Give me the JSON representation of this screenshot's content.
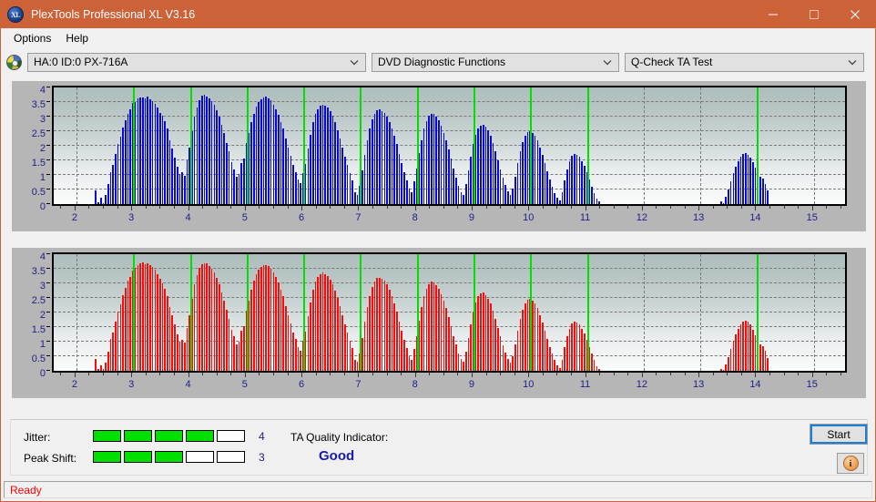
{
  "window": {
    "title": "PlexTools Professional XL V3.16",
    "app_icon": "xl-disc-icon",
    "minimize_label": "Minimize",
    "maximize_label": "Maximize",
    "close_label": "Close",
    "titlebar_color": "#cd6239"
  },
  "menu": {
    "items": [
      {
        "label": "Options"
      },
      {
        "label": "Help"
      }
    ]
  },
  "toolbar": {
    "drive_icon": "disc-icon",
    "drive_select": "HA:0 ID:0  PX-716A",
    "function_select": "DVD Diagnostic Functions",
    "test_select": "Q-Check TA Test"
  },
  "results": {
    "jitter_label": "Jitter:",
    "jitter_value": "4",
    "jitter_segments": 5,
    "jitter_filled": 4,
    "peak_shift_label": "Peak Shift:",
    "peak_shift_value": "3",
    "peak_shift_segments": 5,
    "peak_shift_filled": 3,
    "ta_label": "TA Quality Indicator:",
    "ta_value": "Good",
    "ta_value_color": "#1a1ab0",
    "meter_on_color": "#00e000",
    "start_label": "Start",
    "info_icon": "info-icon"
  },
  "statusbar": {
    "text": "Ready",
    "text_color": "#ff0000"
  },
  "chart_data": [
    {
      "id": "jitter-chart",
      "type": "bar",
      "title": "",
      "xlabel": "",
      "ylabel": "",
      "series_color": "#0a0ad0",
      "marker_color": "#00e000",
      "grid": true,
      "xlim": [
        1.6,
        15.55
      ],
      "ylim": [
        0,
        4
      ],
      "yticks": [
        0,
        0.5,
        1,
        1.5,
        2,
        2.5,
        3,
        3.5,
        4
      ],
      "ytick_labels": [
        "0",
        "0.5",
        "1",
        "1.5",
        "2",
        "2.5",
        "3",
        "3.5",
        "4"
      ],
      "xticks": [
        2,
        3,
        4,
        5,
        6,
        7,
        8,
        9,
        10,
        11,
        12,
        13,
        14,
        15
      ],
      "xtick_labels": [
        "2",
        "3",
        "4",
        "5",
        "6",
        "7",
        "8",
        "9",
        "10",
        "11",
        "12",
        "13",
        "14",
        "15"
      ],
      "markers": [
        3,
        4,
        5,
        6,
        7,
        8,
        9,
        10,
        11,
        14
      ],
      "bar_step": 0.0435,
      "x_start": 2.33,
      "values": [
        0.47,
        0.05,
        0.22,
        0.03,
        0.3,
        0.68,
        1.1,
        1.35,
        1.72,
        2.05,
        2.3,
        2.62,
        2.88,
        3.1,
        3.25,
        3.48,
        3.5,
        3.62,
        3.65,
        3.66,
        3.62,
        3.68,
        3.6,
        3.52,
        3.45,
        3.3,
        3.12,
        3.02,
        2.85,
        2.58,
        2.2,
        1.92,
        1.6,
        1.28,
        1.02,
        1.08,
        0.98,
        1.5,
        1.95,
        2.5,
        3.0,
        3.3,
        3.55,
        3.72,
        3.75,
        3.7,
        3.62,
        3.52,
        3.4,
        3.22,
        3.0,
        2.72,
        2.45,
        2.1,
        1.8,
        1.45,
        1.2,
        0.95,
        1.02,
        1.4,
        1.55,
        2.08,
        2.45,
        2.8,
        3.1,
        3.35,
        3.5,
        3.58,
        3.66,
        3.68,
        3.62,
        3.55,
        3.42,
        3.25,
        3.05,
        2.8,
        2.58,
        2.25,
        1.95,
        1.65,
        1.35,
        1.1,
        0.85,
        0.72,
        1.05,
        1.38,
        1.9,
        2.38,
        2.8,
        3.08,
        3.25,
        3.38,
        3.42,
        3.38,
        3.3,
        3.18,
        3.02,
        2.8,
        2.52,
        2.25,
        1.95,
        1.62,
        1.35,
        1.05,
        0.8,
        0.4,
        0.32,
        0.62,
        1.15,
        1.7,
        2.2,
        2.6,
        2.9,
        3.1,
        3.22,
        3.25,
        3.2,
        3.12,
        3.0,
        2.82,
        2.6,
        2.35,
        2.05,
        1.72,
        1.4,
        1.08,
        0.8,
        0.52,
        0.4,
        0.78,
        1.22,
        1.75,
        2.2,
        2.58,
        2.85,
        3.02,
        3.1,
        3.08,
        3.0,
        2.88,
        2.68,
        2.45,
        2.18,
        1.88,
        1.55,
        1.22,
        0.92,
        0.62,
        0.42,
        0.32,
        0.68,
        1.15,
        1.62,
        2.05,
        2.38,
        2.6,
        2.7,
        2.72,
        2.65,
        2.52,
        2.35,
        2.1,
        1.82,
        1.5,
        1.2,
        0.9,
        0.65,
        0.45,
        0.3,
        0.52,
        0.95,
        1.4,
        1.8,
        2.12,
        2.35,
        2.48,
        2.5,
        2.45,
        2.35,
        2.18,
        1.95,
        1.68,
        1.42,
        1.12,
        0.85,
        0.6,
        0.38,
        0.22,
        0.12,
        0.4,
        0.82,
        1.2,
        1.48,
        1.65,
        1.72,
        1.7,
        1.62,
        1.48,
        1.3,
        1.08,
        0.85,
        0.6,
        0.38,
        0.18,
        0.08
      ],
      "values_tail_x": 13.35,
      "values_tail": [
        0.08,
        0.02,
        0.25,
        0.5,
        0.78,
        1.05,
        1.28,
        1.48,
        1.62,
        1.72,
        1.75,
        1.7,
        1.6,
        1.45,
        1.25,
        1.02,
        0.95,
        0.88,
        0.7,
        0.48
      ]
    },
    {
      "id": "peak-shift-chart",
      "type": "bar",
      "title": "",
      "xlabel": "",
      "ylabel": "",
      "series_color": "#f01010",
      "marker_color": "#00e000",
      "grid": true,
      "xlim": [
        1.6,
        15.55
      ],
      "ylim": [
        0,
        4
      ],
      "yticks": [
        0,
        0.5,
        1,
        1.5,
        2,
        2.5,
        3,
        3.5,
        4
      ],
      "ytick_labels": [
        "0",
        "0.5",
        "1",
        "1.5",
        "2",
        "2.5",
        "3",
        "3.5",
        "4"
      ],
      "xticks": [
        2,
        3,
        4,
        5,
        6,
        7,
        8,
        9,
        10,
        11,
        12,
        13,
        14,
        15
      ],
      "xtick_labels": [
        "2",
        "3",
        "4",
        "5",
        "6",
        "7",
        "8",
        "9",
        "10",
        "11",
        "12",
        "13",
        "14",
        "15"
      ],
      "markers": [
        3,
        4,
        5,
        6,
        7,
        8,
        9,
        10,
        11,
        14
      ],
      "bar_step": 0.0435,
      "x_start": 2.33,
      "values": [
        0.42,
        0.06,
        0.2,
        0.05,
        0.28,
        0.65,
        1.08,
        1.32,
        1.7,
        2.02,
        2.28,
        2.58,
        2.85,
        3.08,
        3.22,
        3.45,
        3.52,
        3.62,
        3.7,
        3.72,
        3.66,
        3.7,
        3.62,
        3.55,
        3.46,
        3.32,
        3.15,
        3.0,
        2.82,
        2.55,
        2.18,
        1.9,
        1.58,
        1.25,
        1.0,
        1.05,
        0.96,
        1.48,
        1.92,
        2.48,
        2.98,
        3.28,
        3.52,
        3.66,
        3.7,
        3.68,
        3.58,
        3.5,
        3.38,
        3.2,
        2.98,
        2.7,
        2.42,
        2.08,
        1.78,
        1.42,
        1.18,
        0.92,
        1.0,
        1.38,
        1.52,
        2.05,
        2.42,
        2.78,
        3.08,
        3.32,
        3.48,
        3.55,
        3.62,
        3.64,
        3.58,
        3.5,
        3.38,
        3.22,
        3.02,
        2.78,
        2.55,
        2.22,
        1.92,
        1.62,
        1.32,
        1.08,
        0.82,
        0.7,
        1.02,
        1.35,
        1.88,
        2.35,
        2.78,
        3.05,
        3.22,
        3.32,
        3.36,
        3.32,
        3.25,
        3.12,
        2.98,
        2.75,
        2.5,
        2.22,
        1.92,
        1.6,
        1.32,
        1.02,
        0.78,
        0.38,
        0.3,
        0.6,
        1.12,
        1.68,
        2.18,
        2.56,
        2.86,
        3.05,
        3.18,
        3.2,
        3.15,
        3.08,
        2.96,
        2.78,
        2.56,
        2.32,
        2.02,
        1.7,
        1.38,
        1.05,
        0.78,
        0.5,
        0.38,
        0.75,
        1.2,
        1.72,
        2.18,
        2.55,
        2.82,
        2.98,
        3.05,
        3.02,
        2.95,
        2.82,
        2.62,
        2.4,
        2.15,
        1.85,
        1.52,
        1.2,
        0.9,
        0.6,
        0.4,
        0.3,
        0.65,
        1.12,
        1.58,
        2.02,
        2.35,
        2.56,
        2.66,
        2.68,
        2.6,
        2.48,
        2.3,
        2.05,
        1.78,
        1.48,
        1.18,
        0.88,
        0.62,
        0.42,
        0.28,
        0.5,
        0.92,
        1.38,
        1.78,
        2.08,
        2.32,
        2.45,
        2.46,
        2.42,
        2.32,
        2.15,
        1.92,
        1.65,
        1.38,
        1.1,
        0.82,
        0.58,
        0.36,
        0.2,
        0.1,
        0.38,
        0.8,
        1.18,
        1.45,
        1.62,
        1.68,
        1.66,
        1.58,
        1.45,
        1.28,
        1.05,
        0.82,
        0.58,
        0.36,
        0.16,
        0.06
      ],
      "values_tail_x": 13.35,
      "values_tail": [
        0.06,
        0.02,
        0.22,
        0.48,
        0.75,
        1.02,
        1.25,
        1.45,
        1.6,
        1.7,
        1.72,
        1.68,
        1.58,
        1.42,
        1.22,
        1.0,
        0.92,
        0.85,
        0.68,
        0.45
      ]
    }
  ]
}
